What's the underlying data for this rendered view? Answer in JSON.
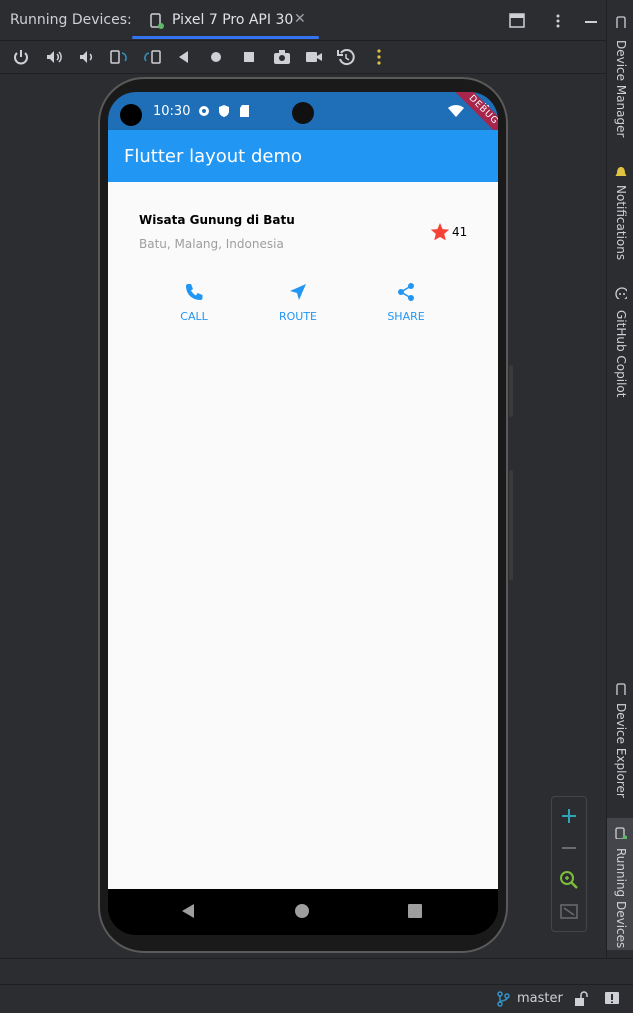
{
  "tabbar": {
    "title": "Running Devices:",
    "tab_label": "Pixel 7 Pro API 30",
    "close_glyph": "✕"
  },
  "toolbar": {
    "icons": [
      "power-icon",
      "volume-up-icon",
      "volume-down-icon",
      "rotate-left-icon",
      "rotate-right-icon",
      "back-icon",
      "home-icon",
      "overview-icon",
      "screenshot-icon",
      "screen-record-icon",
      "reset-icon",
      "more-icon"
    ]
  },
  "side_panels": {
    "device_manager": "Device Manager",
    "notifications": "Notifications",
    "copilot": "GitHub Copilot",
    "device_explorer": "Device Explorer",
    "running_devices": "Running Devices"
  },
  "phone": {
    "status_time": "10:30",
    "debug_banner": "DEBUG",
    "app_title": "Flutter layout demo",
    "place_title": "Wisata Gunung di Batu",
    "place_subtitle": "Batu, Malang, Indonesia",
    "rating": "41",
    "buttons": {
      "call": "CALL",
      "route": "ROUTE",
      "share": "SHARE"
    }
  },
  "statusbar": {
    "branch": "master"
  },
  "colors": {
    "accent": "#2196f3",
    "star": "#f44336",
    "appbar": "#2196f3"
  }
}
